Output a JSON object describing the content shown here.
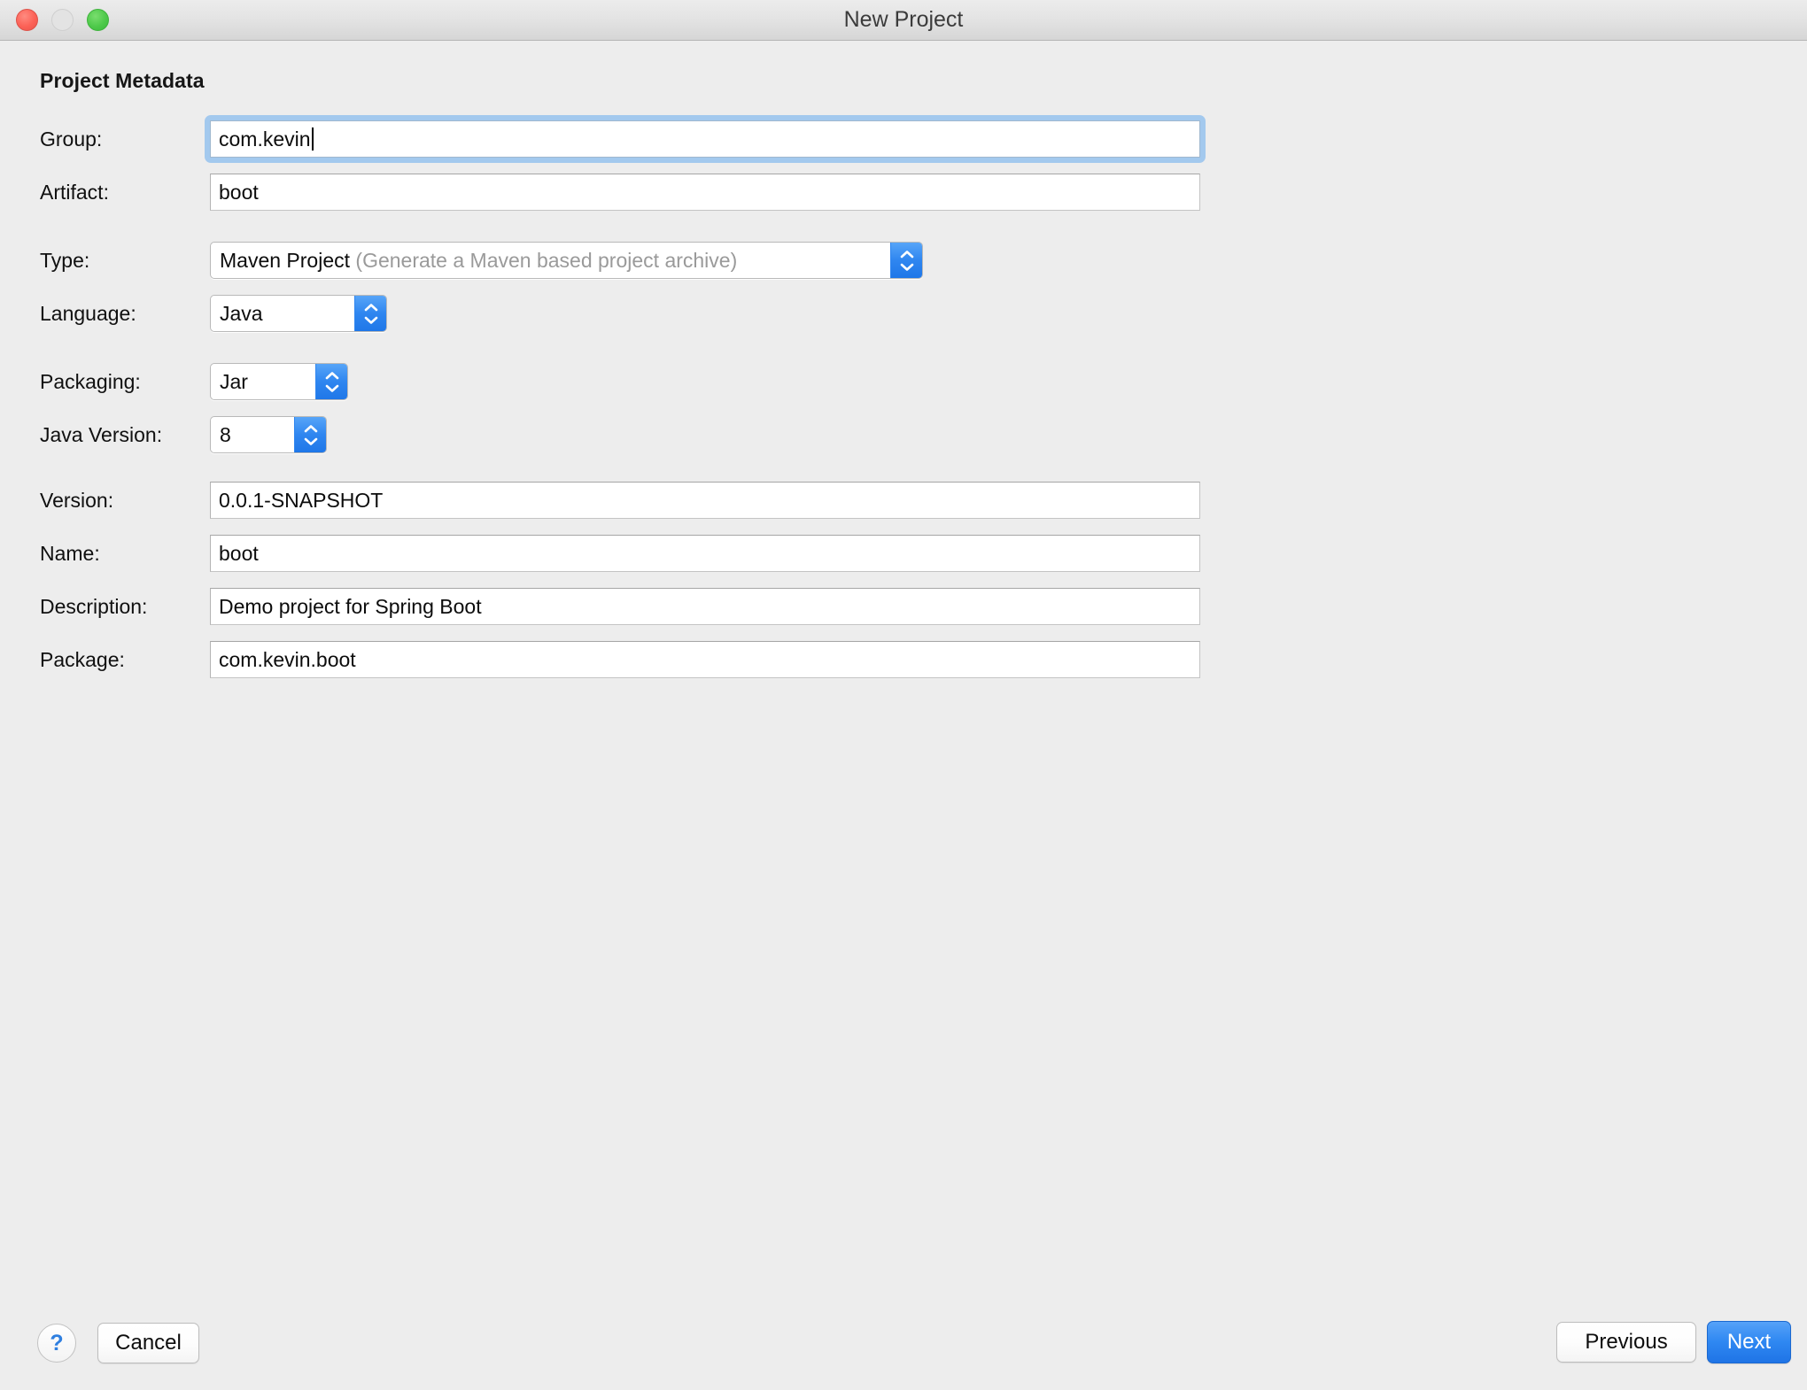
{
  "window": {
    "title": "New Project",
    "controls": {
      "close": "close-button",
      "minimize": "minimize-button-disabled",
      "zoom": "zoom-button"
    }
  },
  "form": {
    "section_title": "Project Metadata",
    "fields": {
      "group": {
        "label": "Group:",
        "value": "com.kevin",
        "focused": true
      },
      "artifact": {
        "label": "Artifact:",
        "value": "boot"
      },
      "type": {
        "label": "Type:",
        "value": "Maven Project",
        "hint": "(Generate a Maven based project archive)"
      },
      "language": {
        "label": "Language:",
        "value": "Java"
      },
      "packaging": {
        "label": "Packaging:",
        "value": "Jar"
      },
      "java_version": {
        "label": "Java Version:",
        "value": "8"
      },
      "version": {
        "label": "Version:",
        "value": "0.0.1-SNAPSHOT"
      },
      "name": {
        "label": "Name:",
        "value": "boot"
      },
      "description": {
        "label": "Description:",
        "value": "Demo project for Spring Boot"
      },
      "package": {
        "label": "Package:",
        "value": "com.kevin.boot"
      }
    }
  },
  "footer": {
    "help_label": "?",
    "cancel_label": "Cancel",
    "previous_label": "Previous",
    "next_label": "Next"
  },
  "colors": {
    "accent_blue": "#2f88f2",
    "focus_ring": "#a3c9ee",
    "window_bg": "#ededed",
    "titlebar_top": "#ececec",
    "titlebar_bottom": "#d6d6d6",
    "close_red": "#fc6156",
    "zoom_green": "#4ec94a",
    "disabled_grey": "#e3e3e3",
    "hint_grey": "#9a9a9a"
  }
}
